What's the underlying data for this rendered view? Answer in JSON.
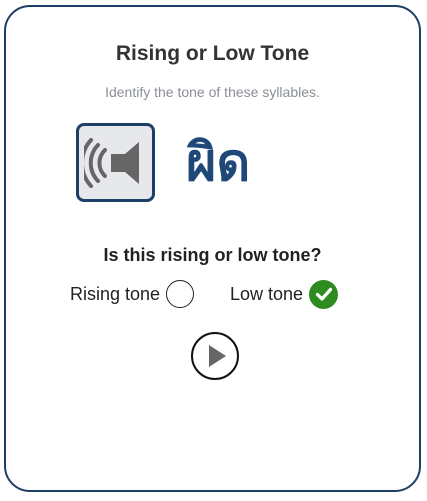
{
  "exercise": {
    "title": "Rising or Low Tone",
    "instruction": "Identify the tone of these syllables.",
    "word": "ผิด",
    "question": "Is this rising or low tone?",
    "options": [
      {
        "label": "Rising tone",
        "state": "unselected"
      },
      {
        "label": "Low tone",
        "state": "correct"
      }
    ]
  },
  "icons": {
    "audio": "speaker-icon",
    "correct": "checkmark-icon",
    "next": "play-icon"
  },
  "colors": {
    "border": "#1e3f66",
    "word": "#1f4878",
    "correct": "#2e8b1f",
    "icon_gray": "#666666"
  }
}
